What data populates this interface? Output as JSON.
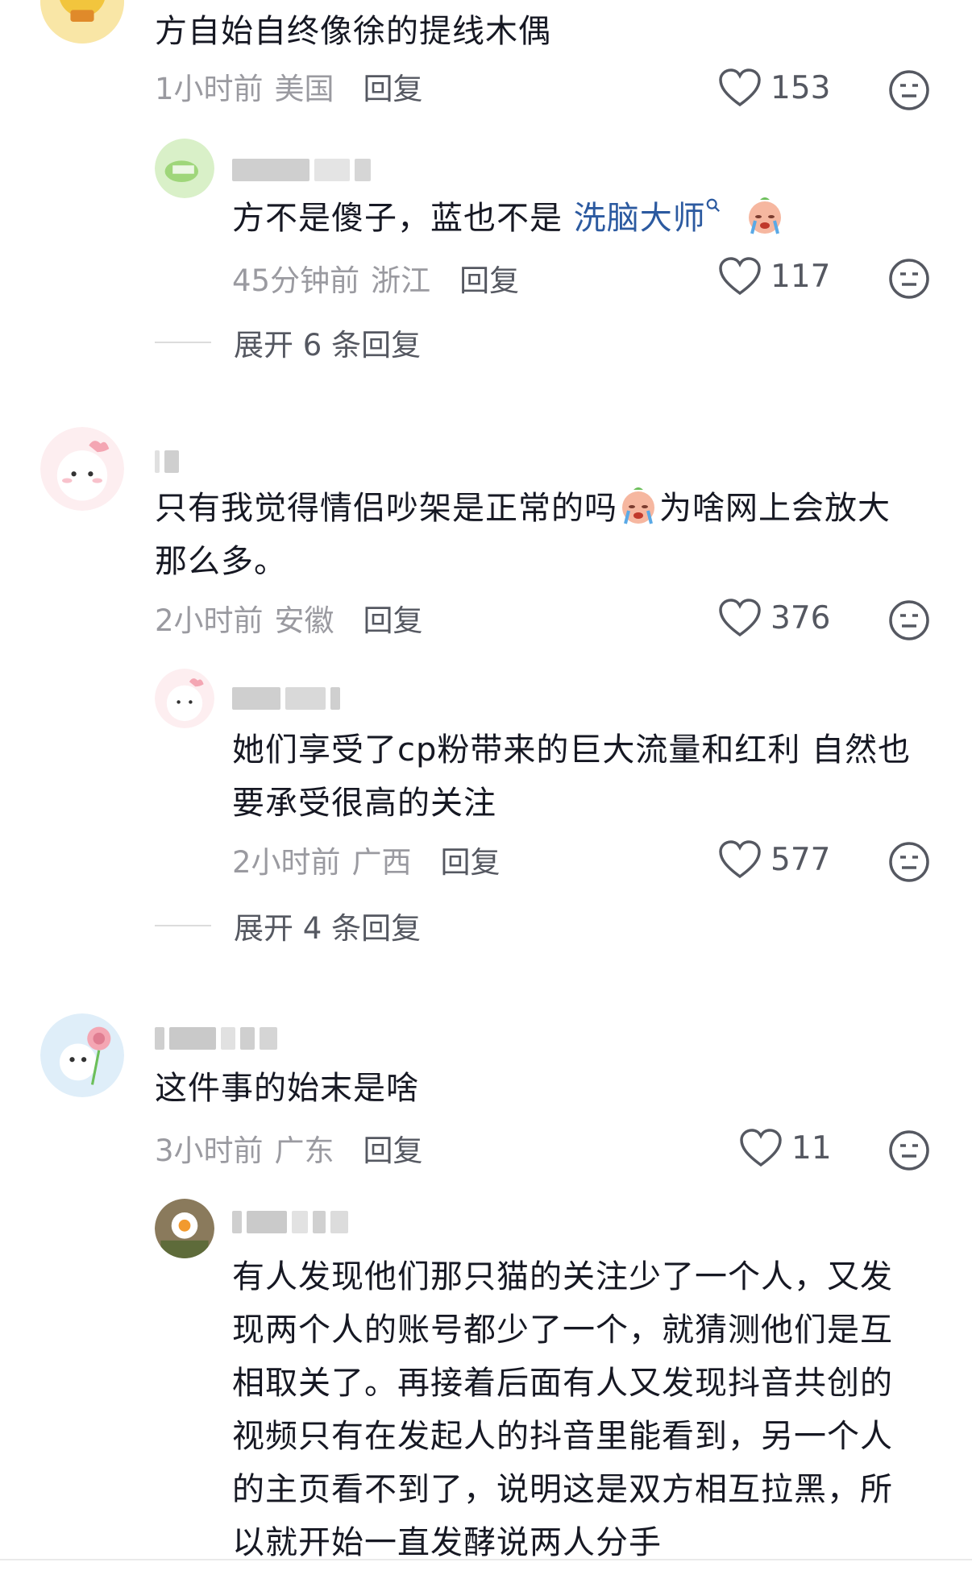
{
  "comments": [
    {
      "text": "方自始自终像徐的提线木偶",
      "time": "1小时前",
      "location": "美国",
      "reply_label": "回复",
      "likes": "153"
    },
    {
      "text_before_link": "方不是傻子，蓝也不是 ",
      "link": "洗脑大师",
      "link_icon": "search-icon",
      "time": "45分钟前",
      "location": "浙江",
      "reply_label": "回复",
      "likes": "117"
    },
    {
      "text": "只有我觉得情侣吵架是正常的吗",
      "text_after_emoji": "为啥网上会放大那么多。",
      "time": "2小时前",
      "location": "安徽",
      "reply_label": "回复",
      "likes": "376"
    },
    {
      "text": "她们享受了cp粉带来的巨大流量和红利 自然也要承受很高的关注",
      "time": "2小时前",
      "location": "广西",
      "reply_label": "回复",
      "likes": "577"
    },
    {
      "text": "这件事的始末是啥",
      "time": "3小时前",
      "location": "广东",
      "reply_label": "回复",
      "likes": "11"
    },
    {
      "text": "有人发现他们那只猫的关注少了一个人，又发现两个人的账号都少了一个，就猜测他们是互相取关了。再接着后面有人又发现抖音共创的视频只有在发起人的抖音里能看到，另一个人的主页看不到了，说明这是双方相互拉黑，所以就开始一直发酵说两人分手"
    }
  ],
  "expand_1": "展开 6 条回复",
  "expand_2": "展开 4 条回复",
  "colors": {
    "text": "#161823",
    "meta": "#9a9aa0",
    "link": "#2c5aa0",
    "background": "#ffffff"
  }
}
